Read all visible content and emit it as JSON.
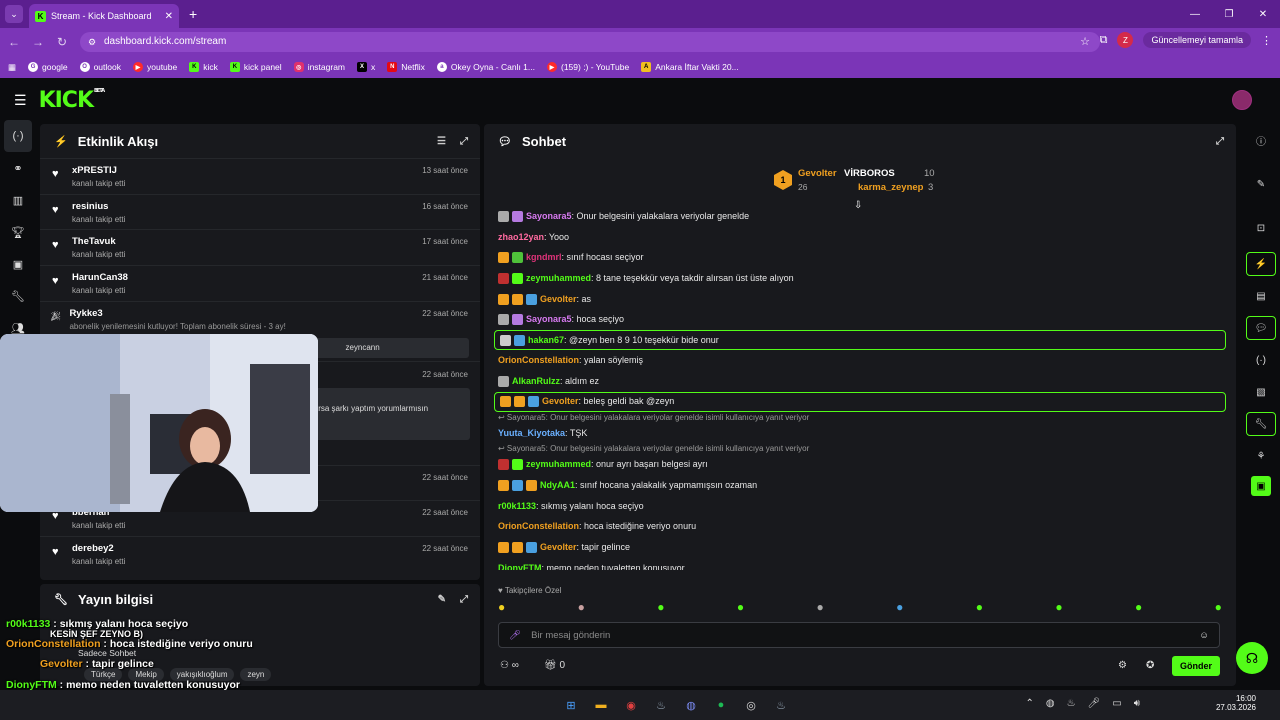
{
  "browser": {
    "tab_title": "Stream - Kick Dashboard",
    "url": "dashboard.kick.com/stream",
    "profile_initial": "Z",
    "update_label": "Güncellemeyi tamamla",
    "bookmarks": [
      "google",
      "outlook",
      "youtube",
      "kick",
      "kick panel",
      "instagram",
      "x",
      "Netflix",
      "Okey Oyna - Canlı 1...",
      "(159) :) - YouTube",
      "Ankara İftar Vakti 20..."
    ]
  },
  "app": {
    "logo": "KICK",
    "logo_badge": "BETA"
  },
  "activity": {
    "title": "Etkinlik Akışı",
    "events": [
      {
        "name": "xPRESTIJ",
        "sub": "kanalı takip etti",
        "time": "13 saat önce"
      },
      {
        "name": "resinius",
        "sub": "kanalı takip etti",
        "time": "16 saat önce"
      },
      {
        "name": "TheTavuk",
        "sub": "kanalı takip etti",
        "time": "17 saat önce"
      },
      {
        "name": "HarunCan38",
        "sub": "kanalı takip etti",
        "time": "21 saat önce"
      },
      {
        "name": "Rykke3",
        "sub": "abonelik yenilemesini kutluyor! Toplam abonelik süresi - 3 ay!",
        "time": "22 saat önce"
      },
      {
        "name": "",
        "sub": "",
        "time": "22 saat önce"
      },
      {
        "name": "",
        "sub": "",
        "time": "22 saat önce"
      },
      {
        "name": "bberhan",
        "sub": "kanalı takip etti",
        "time": "22 saat önce"
      },
      {
        "name": "derebey2",
        "sub": "kanalı takip etti",
        "time": "22 saat önce"
      }
    ],
    "rykke_msg": "zeyncann",
    "partial_msg": "ırsa şarkı yaptım yorumlarmısın"
  },
  "streaminfo": {
    "title": "Yayın bilgisi",
    "tags": [
      "Türkçe",
      "Mekip",
      "yakışıklıoğlum",
      "zeyn"
    ],
    "chat_mode": "Sadece Sohbet"
  },
  "chat": {
    "title": "Sohbet",
    "leaders": [
      {
        "rank": "1",
        "name": "Gevolter",
        "count": "26"
      },
      {
        "name": "VİRBOROS",
        "count": "10"
      },
      {
        "name": "karma_zeynep",
        "count": "3"
      }
    ],
    "messages": [
      {
        "user": "Sayonara5",
        "color": "#d77af0",
        "text": ": Onur belgesini yalakalara veriyolar genelde",
        "badges": [
          "#aaaaaa",
          "#b57ae0"
        ]
      },
      {
        "user": "zhao12yan",
        "color": "#ff6aa0",
        "text": ": Yooo",
        "badges": []
      },
      {
        "user": "kgndmrl",
        "color": "#e0337a",
        "text": ": sınıf hocası seçiyor",
        "badges": [
          "#f0a020",
          "#4fc23a"
        ]
      },
      {
        "user": "zeymuhammed",
        "color": "#53fc18",
        "text": ": 8 tane teşekkür veya takdir alırsan üst üste alıyon",
        "badges": [
          "#c03030",
          "#53fc18"
        ]
      },
      {
        "user": "Gevolter",
        "color": "#f0a020",
        "text": ": as",
        "badges": [
          "#f0a020",
          "#f0a020",
          "#4aa0e0"
        ]
      },
      {
        "user": "Sayonara5",
        "color": "#d77af0",
        "text": ": hoca seçiyo",
        "badges": [
          "#aaaaaa",
          "#b57ae0"
        ]
      },
      {
        "user": "hakan67",
        "color": "#53fc18",
        "text": ": @zeyn ben 8 9 10 teşekkür bide onur",
        "badges": [
          "#cccccc",
          "#4aa0e0"
        ],
        "highlight": true
      },
      {
        "user": "OrionConstellation",
        "color": "#f0a020",
        "text": ": yalan söylemiş",
        "badges": []
      },
      {
        "user": "AlkanRulzz",
        "color": "#53fc18",
        "text": ": aldım ez",
        "badges": [
          "#aaaaaa"
        ]
      },
      {
        "user": "Gevolter",
        "color": "#f0a020",
        "text": ": beleş geldi bak @zeyn",
        "badges": [
          "#f0a020",
          "#f0a020",
          "#4aa0e0"
        ],
        "highlight": true
      },
      {
        "reply": "Sayonara5: Onur belgesini yalakalara veriyolar genelde isimli kullanıcıya yanıt veriyor"
      },
      {
        "user": "Yuuta_Kiyotaka",
        "color": "#6ab0ff",
        "text": ": TŞK",
        "badges": []
      },
      {
        "reply": "Sayonara5: Onur belgesini yalakalara veriyolar genelde isimli kullanıcıya yanıt veriyor"
      },
      {
        "user": "zeymuhammed",
        "color": "#53fc18",
        "text": ": onur ayrı başarı belgesi ayrı",
        "badges": [
          "#c03030",
          "#53fc18"
        ]
      },
      {
        "user": "NdyAA1",
        "color": "#53fc18",
        "text": ": sınıf hocana yalakalık yapmamışsın ozaman",
        "badges": [
          "#f0a020",
          "#4aa0e0",
          "#f0a020"
        ]
      },
      {
        "user": "r00k1133",
        "color": "#53fc18",
        "text": ": sıkmış yalanı hoca seçiyo",
        "badges": []
      },
      {
        "user": "OrionConstellation",
        "color": "#f0a020",
        "text": ": hoca istediğine veriyo onuru",
        "badges": []
      },
      {
        "user": "Gevolter",
        "color": "#f0a020",
        "text": ": tapir gelince",
        "badges": [
          "#f0a020",
          "#f0a020",
          "#4aa0e0"
        ]
      },
      {
        "user": "DionyFTM",
        "color": "#53fc18",
        "text": ": memo neden tuvaletten konusuyor",
        "badges": []
      }
    ],
    "followers_only": "Takipçilere Özel",
    "input_placeholder": "Bir mesaj gönderin",
    "send_label": "Gönder",
    "points": "∞",
    "gift_count": "0"
  },
  "overlay": {
    "lines": [
      {
        "user": "r00k1133",
        "text": " : sıkmış yalanı hoca seçiyo"
      },
      {
        "user": "",
        "text": "KESİN ŞEF ZEYNO B)"
      },
      {
        "user": "OrionConstellation",
        "text": " : hoca istediğine veriyo onuru"
      },
      {
        "user": "Gevolter",
        "text": " : tapir gelince"
      },
      {
        "user": "DionyFTM",
        "text": " : memo neden tuvaletten konusuyor"
      }
    ]
  },
  "taskbar": {
    "time": "16:00",
    "date": "27.03.2026"
  },
  "colors": {
    "accent": "#53fc18",
    "browser": "#7b35b7",
    "panel": "#18191d"
  }
}
